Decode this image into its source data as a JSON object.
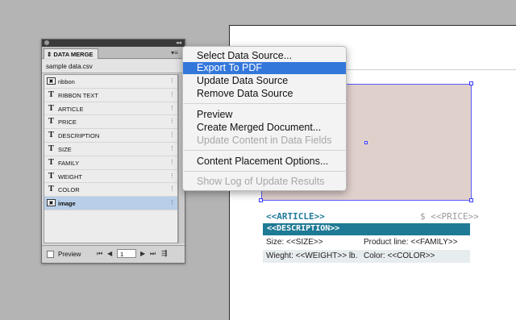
{
  "panel": {
    "title": "DATA MERGE",
    "collapse_icon": "collapse-arrows-icon",
    "menu_icon": "panel-menu-icon",
    "source_file": "sample data.csv",
    "fields": [
      {
        "label": "ribbon",
        "type": "image"
      },
      {
        "label": "RIBBON TEXT",
        "type": "text"
      },
      {
        "label": "ARTICLE",
        "type": "text"
      },
      {
        "label": "PRICE",
        "type": "text"
      },
      {
        "label": "DESCRIPTION",
        "type": "text"
      },
      {
        "label": "SIZE",
        "type": "text"
      },
      {
        "label": "FAMILY",
        "type": "text"
      },
      {
        "label": "WEIGHT",
        "type": "text"
      },
      {
        "label": "COLOR",
        "type": "text"
      },
      {
        "label": "image",
        "type": "image",
        "selected": true
      }
    ],
    "footer": {
      "preview_label": "Preview",
      "record_number": "1"
    }
  },
  "menu": {
    "items": [
      {
        "label": "Select Data Source...",
        "state": "normal"
      },
      {
        "label": "Export To PDF",
        "state": "highlight"
      },
      {
        "label": "Update Data Source",
        "state": "normal"
      },
      {
        "label": "Remove Data Source",
        "state": "normal"
      },
      {
        "label": "Preview",
        "state": "normal"
      },
      {
        "label": "Create Merged Document...",
        "state": "normal"
      },
      {
        "label": "Update Content in Data Fields",
        "state": "disabled"
      },
      {
        "label": "Content Placement Options...",
        "state": "normal"
      },
      {
        "label": "Show Log of Update Results",
        "state": "disabled"
      }
    ]
  },
  "document": {
    "article": "<<ARTICLE>>",
    "price": "$ <<PRICE>>",
    "description": "<<DESCRIPTION>>",
    "size": "Size: <<SIZE>>",
    "product_line": "Product line: <<FAMILY>>",
    "weight": "Wieght: <<WEIGHT>> lb.",
    "color": "Color: <<COLOR>>"
  },
  "colors": {
    "menu_highlight": "#3477db",
    "description_bar": "#1f7a95",
    "image_frame": "#e0d0cc"
  }
}
